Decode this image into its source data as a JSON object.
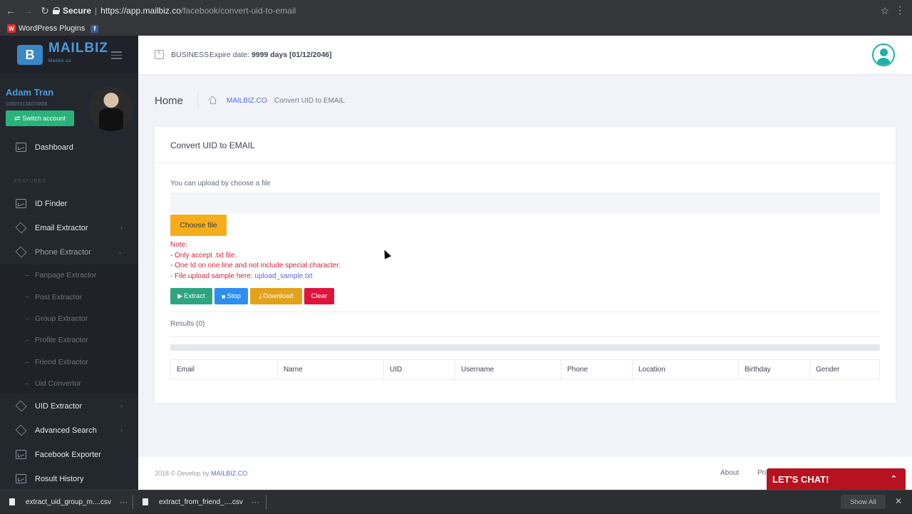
{
  "browser": {
    "secure_label": "Secure",
    "url_host": "https://app.mailbiz.co",
    "url_path": "/facebook/convert-uid-to-email",
    "bookmarks": [
      {
        "label": "WordPress Plugins",
        "badge": "W"
      },
      {
        "label": "",
        "badge": "f"
      }
    ]
  },
  "sidebar": {
    "logo_text": "MAILBIZ",
    "logo_sub": "Mailbiz.co",
    "logo_letter": "B",
    "user_name": "Adam Tran",
    "user_id": "100010134074808",
    "switch_label": "Switch account",
    "dashboard": "Dashboard",
    "section_label": "FEATURES",
    "items": {
      "id_finder": "ID Finder",
      "email_extractor": "Email Extractor",
      "phone_extractor": "Phone Extractor",
      "uid_extractor": "UID Extractor",
      "advanced_search": "Advanced Search",
      "facebook_exporter": "Facebook Exporter",
      "result_history": "Rosult History"
    },
    "sub_items": [
      "Fanpage Extractor",
      "Post Extractor",
      "Group Extractor",
      "Profile Extractor",
      "Friend Extractor",
      "Uid Convertor"
    ]
  },
  "topbar": {
    "plan": "BUSINESS",
    "expire_label": "Expire date:",
    "expire_value": "9999 days [01/12/2046]"
  },
  "page": {
    "title": "Home",
    "crumb_link": "MAILBIZ.CO",
    "crumb_sep": "-",
    "crumb_current": "Convert UID to EMAIL"
  },
  "card": {
    "title": "Convert UID to EMAIL",
    "upload_label": "You can upload by choose a file",
    "choose_file": "Choose file",
    "note_title": "Note:",
    "note_lines": [
      "- Only accept .txt file.",
      "- One Id on one line and not include special character.",
      "- File upload sample here: "
    ],
    "sample_link": "upload_sample.txt",
    "buttons": {
      "extract": "Extract",
      "stop": "Stop",
      "download": "Download",
      "clear": "Clear"
    },
    "results": "Results (0)",
    "progress_fraction": 0,
    "columns": [
      "Email",
      "Name",
      "UID",
      "Username",
      "Phone",
      "Location",
      "Birthday",
      "Gender"
    ]
  },
  "footer": {
    "copy_prefix": "2018 © Develop by ",
    "copy_link": "MAILBIZ.CO",
    "about": "About",
    "privacy_partial": "Pri"
  },
  "chat": {
    "label": "LET'S CHAT!"
  },
  "downloads": {
    "files": [
      "extract_uid_group_m....csv",
      "extract_from_friend_....csv"
    ],
    "show_all": "Show All"
  }
}
